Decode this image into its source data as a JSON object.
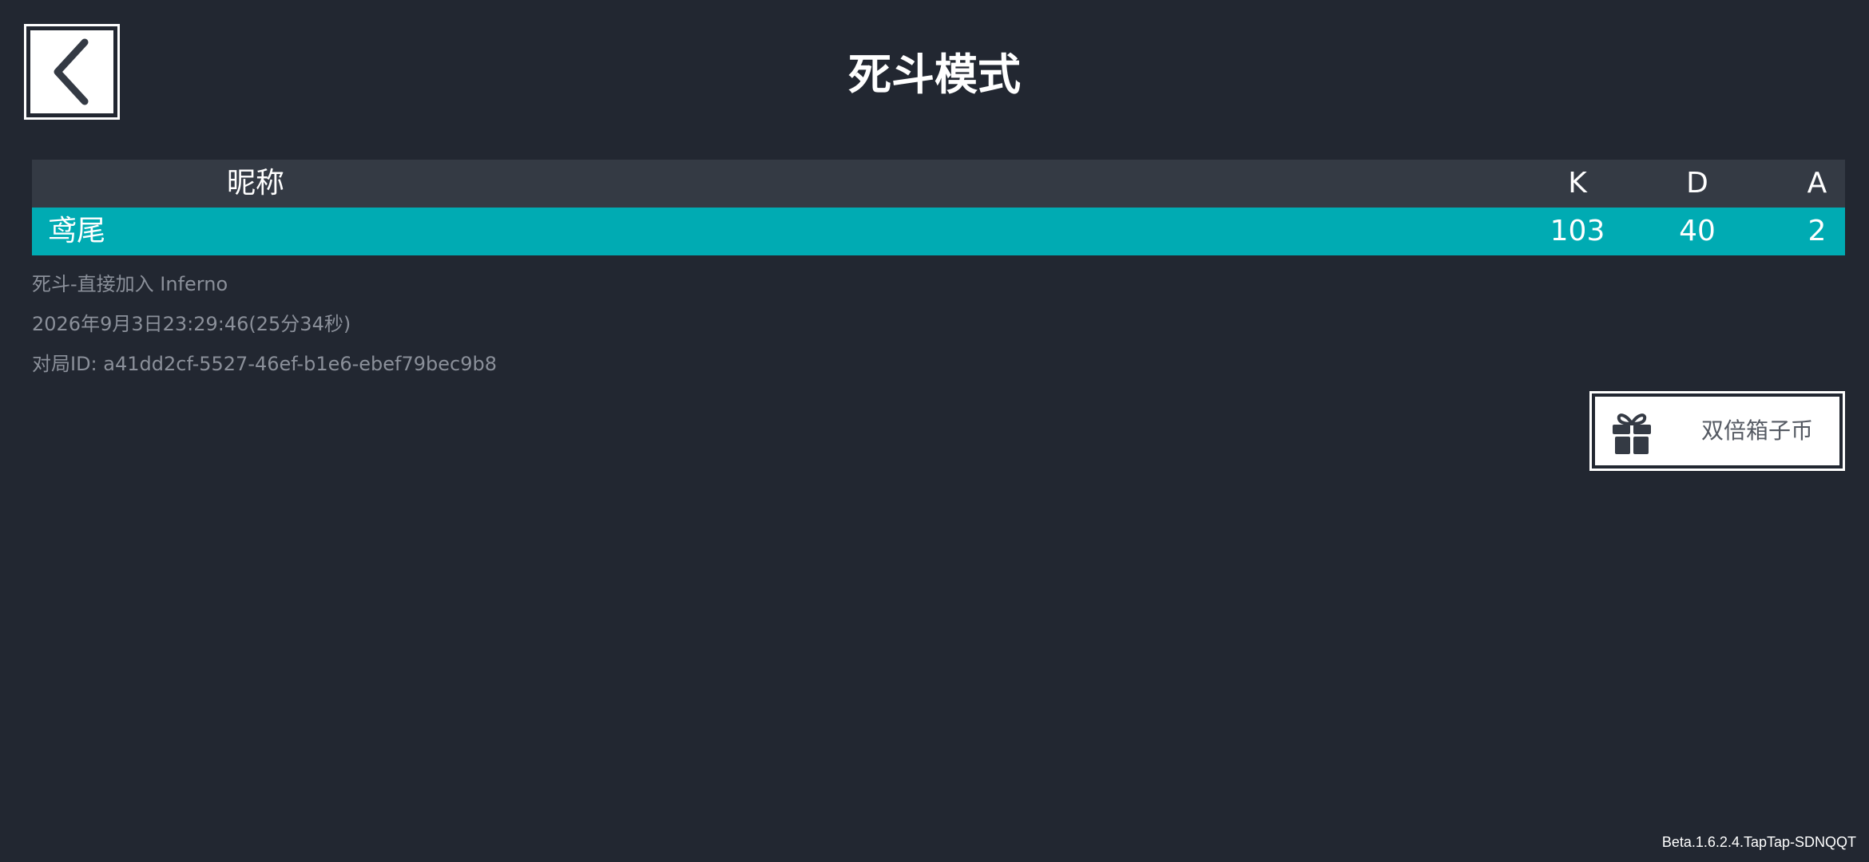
{
  "header": {
    "title": "死斗模式",
    "back_icon": "chevron-left-icon"
  },
  "table": {
    "columns": {
      "name": "昵称",
      "k": "K",
      "d": "D",
      "a": "A"
    },
    "rows": [
      {
        "name": "鸢尾",
        "k": "103",
        "d": "40",
        "a": "2",
        "highlight_color": "#00abb3"
      }
    ]
  },
  "match_info": {
    "mode_map": "死斗-直接加入 Inferno",
    "datetime_duration": "2026年9月3日23:29:46(25分34秒)",
    "match_id": "对局ID: a41dd2cf-5527-46ef-b1e6-ebef79bec9b8"
  },
  "double_coin": {
    "label": "双倍箱子币",
    "icon": "gift-icon"
  },
  "footer": {
    "version": "Beta.1.6.2.4.TapTap-SDNQQT"
  },
  "colors": {
    "background": "#222731",
    "header_row": "#343a44",
    "accent": "#00abb3"
  }
}
